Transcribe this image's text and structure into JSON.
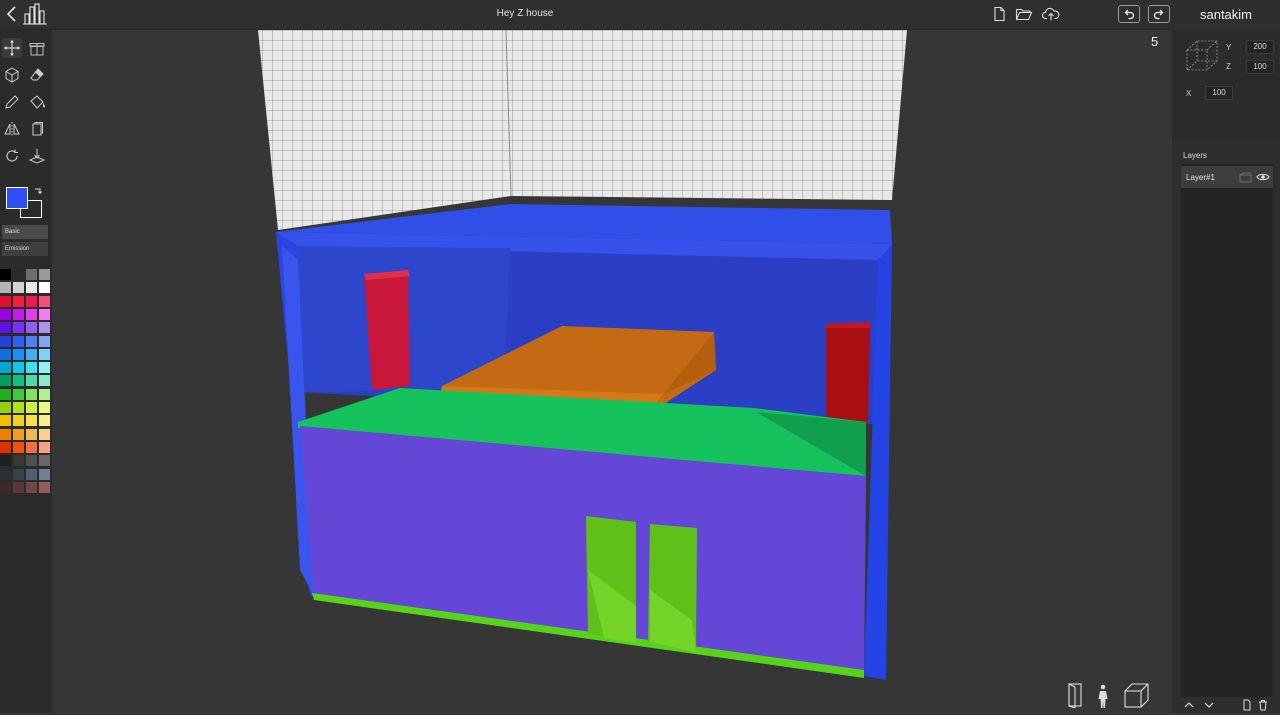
{
  "header": {
    "title": "Hey Z house"
  },
  "user": {
    "name": "santakim"
  },
  "step_counter": "5",
  "size": {
    "y_label": "Y",
    "y_value": "200",
    "z_label": "Z",
    "z_value": "100",
    "x_label": "X",
    "x_value": "100"
  },
  "materials": {
    "basic": "Basic",
    "emission": "Emission"
  },
  "layers": {
    "title": "Layers",
    "items": [
      {
        "name": "Layer#1"
      }
    ]
  },
  "colors": {
    "primary": "#2f4ff5",
    "secondary": "#2b2b2b"
  },
  "palette": [
    [
      "#000000",
      "#2a2a2a",
      "#6e6e6e",
      "#9a9a9a"
    ],
    [
      "#b4b4b4",
      "#d2d2d2",
      "#e8e8e8",
      "#ffffff"
    ],
    [
      "#e0102a",
      "#f0203c",
      "#f01850",
      "#f0507a"
    ],
    [
      "#a000e0",
      "#c020e8",
      "#e040e8",
      "#f080f0"
    ],
    [
      "#6010e0",
      "#7a30f0",
      "#9060f0",
      "#b090f0"
    ],
    [
      "#2040e0",
      "#3060f0",
      "#5080f0",
      "#80a8f0"
    ],
    [
      "#1070e0",
      "#2090f0",
      "#40b0f0",
      "#80d0f8"
    ],
    [
      "#00a8d0",
      "#10c8e8",
      "#40e0f0",
      "#90f0f8"
    ],
    [
      "#00a060",
      "#10c080",
      "#50d8a8",
      "#90e8c8"
    ],
    [
      "#20b020",
      "#40c840",
      "#80e060",
      "#b0f090"
    ],
    [
      "#90d010",
      "#b0e020",
      "#d0f040",
      "#e8f880"
    ],
    [
      "#f0c000",
      "#f0d020",
      "#f8e050",
      "#f8f090"
    ],
    [
      "#f08000",
      "#f0a020",
      "#f0b850",
      "#f8d090"
    ],
    [
      "#e03000",
      "#f05010",
      "#f07040",
      "#f8a080"
    ],
    [
      "#202020",
      "#383838",
      "#505050",
      "#686868"
    ],
    [
      "#283038",
      "#384048",
      "#506070",
      "#708090"
    ],
    [
      "#402828",
      "#583838",
      "#704848",
      "#906060"
    ]
  ],
  "icons": {
    "back": "chevron-left-icon",
    "logo": "city-logo-icon",
    "new_file": "new-file-icon",
    "open": "folder-open-icon",
    "upload": "cloud-upload-icon",
    "undo": "undo-icon",
    "redo": "redo-icon"
  }
}
